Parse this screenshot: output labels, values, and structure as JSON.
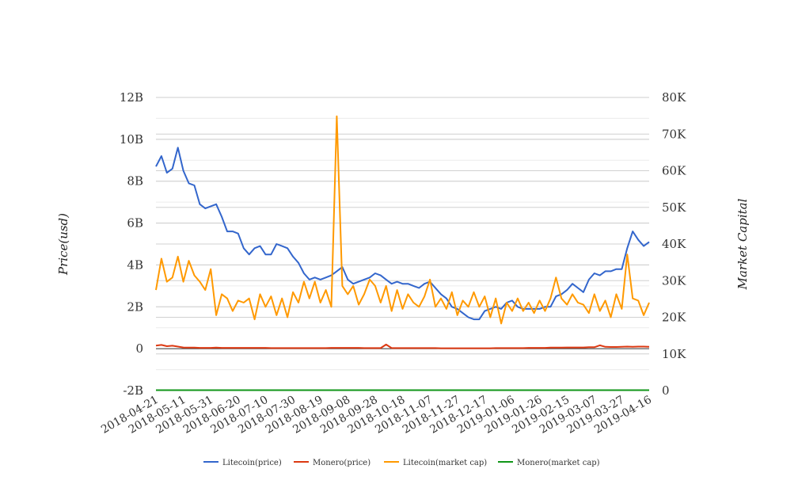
{
  "chart_data": {
    "type": "line",
    "title": "",
    "ylabel_left": "Price(usd)",
    "ylabel_right": "Market Capital",
    "left_axis": {
      "ticks": [
        "-2B",
        "0",
        "2B",
        "4B",
        "6B",
        "8B",
        "10B",
        "12B"
      ],
      "range_billions": [
        -2,
        12
      ]
    },
    "right_axis": {
      "ticks": [
        "0",
        "10K",
        "20K",
        "30K",
        "40K",
        "50K",
        "60K",
        "70K",
        "80K"
      ],
      "range_thousands": [
        0,
        80
      ]
    },
    "x_start": "2018-04-21",
    "x_span_days": 360,
    "x_tick_labels": [
      "2018-04-21",
      "2018-05-11",
      "2018-05-31",
      "2018-06-20",
      "2018-07-10",
      "2018-07-30",
      "2018-08-19",
      "2018-09-08",
      "2018-09-28",
      "2018-10-18",
      "2018-11-07",
      "2018-11-27",
      "2018-12-17",
      "2019-01-06",
      "2019-01-26",
      "2019-02-15",
      "2019-03-07",
      "2019-03-27",
      "2019-04-16"
    ],
    "sample_step_days": 4,
    "legend_position": "bottom",
    "series": [
      {
        "name": "Litecoin(price)",
        "color": "#3366cc",
        "axis": "left",
        "values": [
          8.7,
          9.2,
          8.4,
          8.6,
          9.6,
          8.5,
          7.9,
          7.8,
          6.9,
          6.7,
          6.8,
          6.9,
          6.3,
          5.6,
          5.6,
          5.5,
          4.8,
          4.5,
          4.8,
          4.9,
          4.5,
          4.5,
          5.0,
          4.9,
          4.8,
          4.4,
          4.1,
          3.6,
          3.3,
          3.4,
          3.3,
          3.4,
          3.5,
          3.7,
          3.9,
          3.3,
          3.1,
          3.2,
          3.3,
          3.4,
          3.6,
          3.5,
          3.3,
          3.1,
          3.2,
          3.1,
          3.1,
          3.0,
          2.9,
          3.1,
          3.2,
          2.9,
          2.6,
          2.4,
          2.0,
          1.9,
          1.7,
          1.5,
          1.4,
          1.4,
          1.8,
          1.9,
          2.0,
          1.9,
          2.2,
          2.3,
          2.0,
          1.9,
          1.9,
          1.9,
          1.9,
          2.0,
          2.0,
          2.5,
          2.6,
          2.8,
          3.1,
          2.9,
          2.7,
          3.3,
          3.6,
          3.5,
          3.7,
          3.7,
          3.8,
          3.8,
          4.8,
          5.6,
          5.2,
          4.9,
          5.1
        ]
      },
      {
        "name": "Monero(price)",
        "color": "#dc3912",
        "axis": "left",
        "values": [
          0.15,
          0.18,
          0.12,
          0.14,
          0.1,
          0.06,
          0.05,
          0.05,
          0.04,
          0.04,
          0.04,
          0.05,
          0.04,
          0.04,
          0.04,
          0.04,
          0.04,
          0.04,
          0.04,
          0.04,
          0.04,
          0.03,
          0.03,
          0.03,
          0.03,
          0.03,
          0.03,
          0.03,
          0.03,
          0.03,
          0.03,
          0.03,
          0.04,
          0.04,
          0.04,
          0.04,
          0.04,
          0.04,
          0.03,
          0.03,
          0.03,
          0.03,
          0.2,
          0.03,
          0.03,
          0.03,
          0.03,
          0.03,
          0.03,
          0.03,
          0.03,
          0.03,
          0.02,
          0.02,
          0.02,
          0.02,
          0.02,
          0.02,
          0.02,
          0.02,
          0.02,
          0.02,
          0.03,
          0.03,
          0.03,
          0.03,
          0.03,
          0.03,
          0.04,
          0.04,
          0.04,
          0.04,
          0.05,
          0.05,
          0.05,
          0.06,
          0.06,
          0.06,
          0.06,
          0.07,
          0.07,
          0.16,
          0.09,
          0.08,
          0.08,
          0.09,
          0.1,
          0.09,
          0.1,
          0.1,
          0.09
        ]
      },
      {
        "name": "Litecoin(market cap)",
        "color": "#ff9900",
        "axis": "left",
        "values": [
          2.8,
          4.3,
          3.2,
          3.4,
          4.4,
          3.2,
          4.2,
          3.5,
          3.2,
          2.8,
          3.8,
          1.6,
          2.6,
          2.4,
          1.8,
          2.3,
          2.2,
          2.4,
          1.4,
          2.6,
          2.0,
          2.5,
          1.6,
          2.4,
          1.5,
          2.7,
          2.2,
          3.2,
          2.4,
          3.2,
          2.2,
          2.8,
          2.0,
          11.1,
          3.0,
          2.6,
          3.0,
          2.1,
          2.6,
          3.3,
          3.0,
          2.2,
          3.0,
          1.8,
          2.8,
          1.9,
          2.6,
          2.2,
          2.0,
          2.5,
          3.3,
          2.0,
          2.4,
          1.9,
          2.7,
          1.6,
          2.3,
          2.0,
          2.7,
          2.0,
          2.5,
          1.5,
          2.4,
          1.2,
          2.2,
          1.8,
          2.4,
          1.8,
          2.2,
          1.7,
          2.3,
          1.8,
          2.4,
          3.4,
          2.4,
          2.1,
          2.6,
          2.2,
          2.1,
          1.7,
          2.6,
          1.8,
          2.3,
          1.5,
          2.6,
          1.9,
          4.5,
          2.4,
          2.3,
          1.6,
          2.2
        ]
      },
      {
        "name": "Monero(market cap)",
        "color": "#109618",
        "axis": "right",
        "values": [
          0.1,
          0.1,
          0.1,
          0.1,
          0.1,
          0.1,
          0.1,
          0.1,
          0.1,
          0.1,
          0.1,
          0.1,
          0.1,
          0.1,
          0.1,
          0.1,
          0.1,
          0.1,
          0.1,
          0.1,
          0.1,
          0.1,
          0.1,
          0.1,
          0.1,
          0.1,
          0.1,
          0.1,
          0.1,
          0.1,
          0.1,
          0.1,
          0.1,
          0.1,
          0.1,
          0.1,
          0.1,
          0.1,
          0.1,
          0.1,
          0.1,
          0.1,
          0.1,
          0.1,
          0.1,
          0.1,
          0.1,
          0.1,
          0.1,
          0.1,
          0.1,
          0.1,
          0.1,
          0.1,
          0.1,
          0.1,
          0.1,
          0.1,
          0.1,
          0.1,
          0.1,
          0.1,
          0.1,
          0.1,
          0.1,
          0.1,
          0.1,
          0.1,
          0.1,
          0.1,
          0.1,
          0.1,
          0.1,
          0.1,
          0.1,
          0.1,
          0.1,
          0.1,
          0.1,
          0.1,
          0.1,
          0.1,
          0.1,
          0.1,
          0.1,
          0.1,
          0.1,
          0.1,
          0.1,
          0.1,
          0.1
        ]
      }
    ]
  }
}
